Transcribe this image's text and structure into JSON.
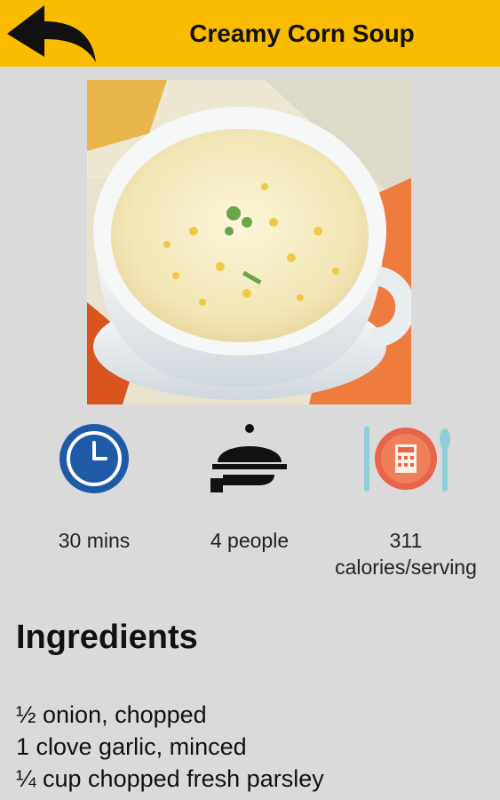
{
  "header": {
    "title": "Creamy Corn Soup",
    "back_icon": "back-arrow-icon",
    "color": "#f9bc00"
  },
  "hero_image": {
    "alt": "bowl of creamy corn soup"
  },
  "stats": [
    {
      "icon": "clock-icon",
      "label": "30 mins"
    },
    {
      "icon": "serving-cloche-icon",
      "label": "4 people"
    },
    {
      "icon": "calculator-plate-icon",
      "label_line1": "311",
      "label_line2": "calories/serving"
    }
  ],
  "ingredients": {
    "title": "Ingredients",
    "items": [
      "½ onion, chopped",
      "1 clove garlic, minced",
      "¼ cup chopped fresh parsley"
    ]
  }
}
